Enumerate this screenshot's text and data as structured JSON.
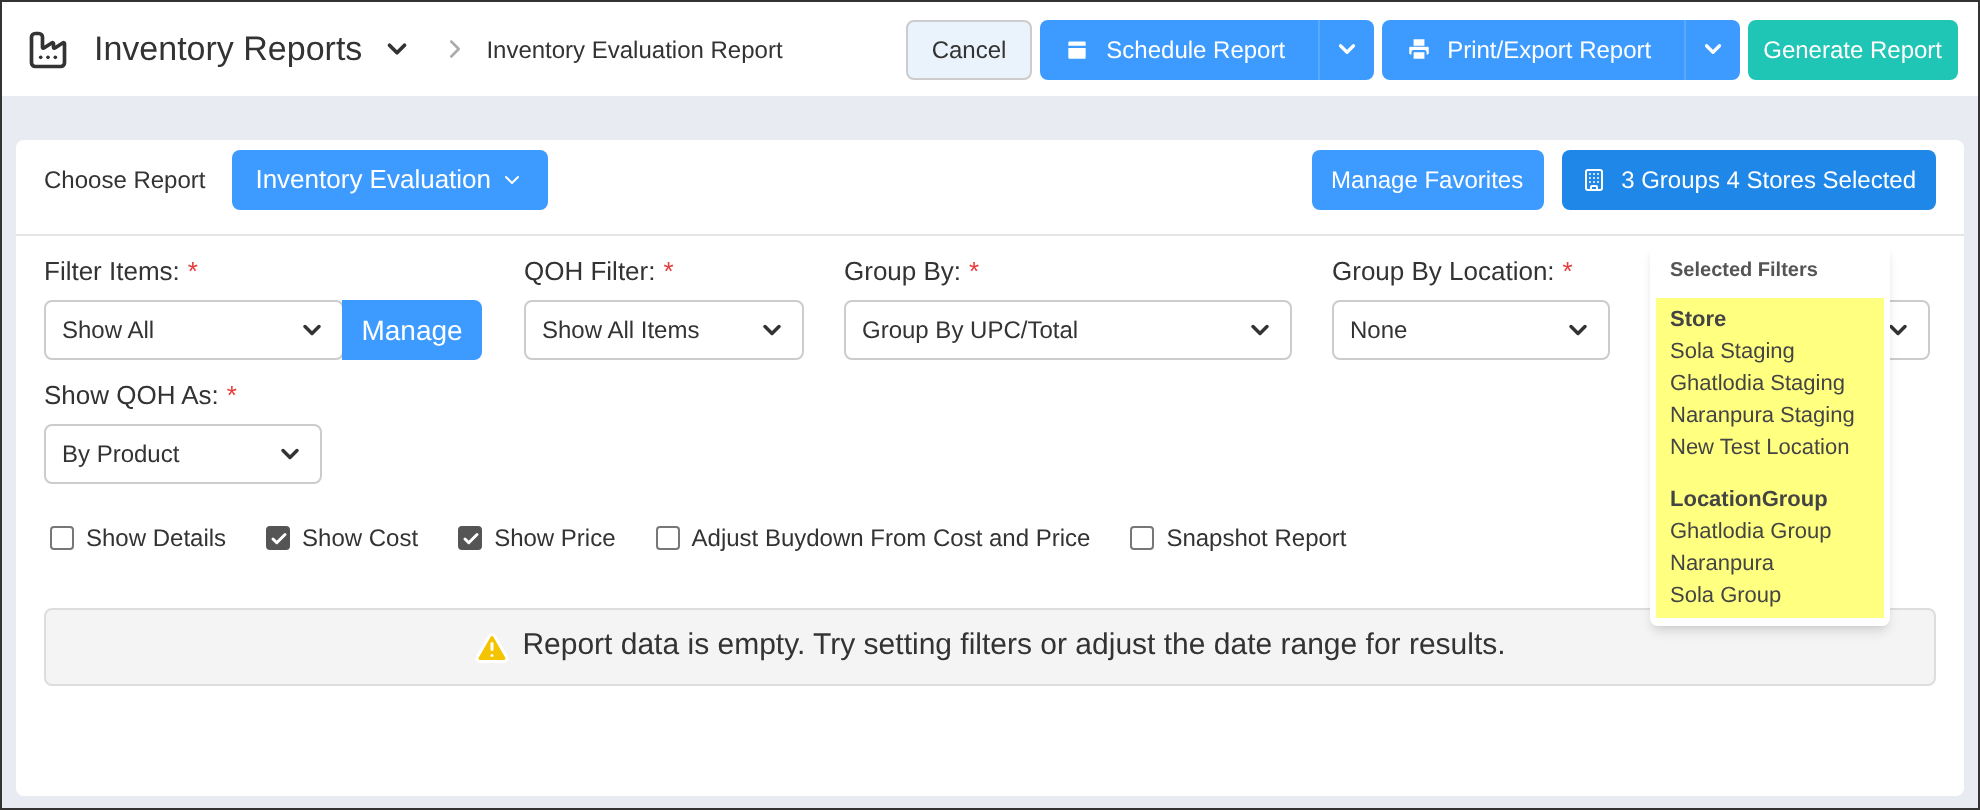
{
  "header": {
    "title": "Inventory Reports",
    "breadcrumb": "Inventory Evaluation Report",
    "actions": [
      {
        "kind": "plain",
        "label": "Cancel"
      },
      {
        "kind": "split",
        "label": "Schedule Report"
      },
      {
        "kind": "split",
        "label": "Print/Export Report"
      },
      {
        "kind": "primary",
        "label": "Generate Report"
      }
    ]
  },
  "choose_report": {
    "label": "Choose Report",
    "value": "Inventory Evaluation"
  },
  "manage_favorites": "Manage Favorites",
  "selection_button": "3 Groups 4 Stores Selected",
  "filter_rows": [
    {
      "fields": [
        {
          "kind": "select_with_button",
          "label": "Filter Items:",
          "required_mark": "*",
          "value": "Show All",
          "button": "Manage"
        },
        {
          "kind": "select",
          "label": "QOH Filter:",
          "required_mark": "*",
          "value": "Show All Items"
        },
        {
          "kind": "select",
          "label": "Group By:",
          "required_mark": "*",
          "value": "Group By UPC/Total"
        },
        {
          "kind": "select",
          "label": "Group By Location:",
          "required_mark": "*",
          "value": "None"
        },
        {
          "kind": "covered_select"
        }
      ]
    },
    {
      "fields": [
        {
          "kind": "select",
          "label": "Show QOH As:",
          "required_mark": "*",
          "value": "By Product"
        }
      ]
    }
  ],
  "options": [
    {
      "label": "Show Details",
      "checked": false
    },
    {
      "label": "Show Cost",
      "checked": true
    },
    {
      "label": "Show Price",
      "checked": true
    },
    {
      "label": "Adjust Buydown From Cost and Price",
      "checked": false
    },
    {
      "label": "Snapshot Report",
      "checked": false
    }
  ],
  "empty_message": "Report data is empty. Try setting filters or adjust the date range for results.",
  "selected_filters": {
    "title": "Selected Filters",
    "groups": [
      {
        "heading": "Store",
        "items": [
          "Sola Staging",
          "Ghatlodia Staging",
          "Naranpura Staging",
          "New Test Location"
        ]
      },
      {
        "heading": "LocationGroup",
        "items": [
          "Ghatlodia Group",
          "Naranpura",
          "Sola Group"
        ]
      }
    ]
  }
}
